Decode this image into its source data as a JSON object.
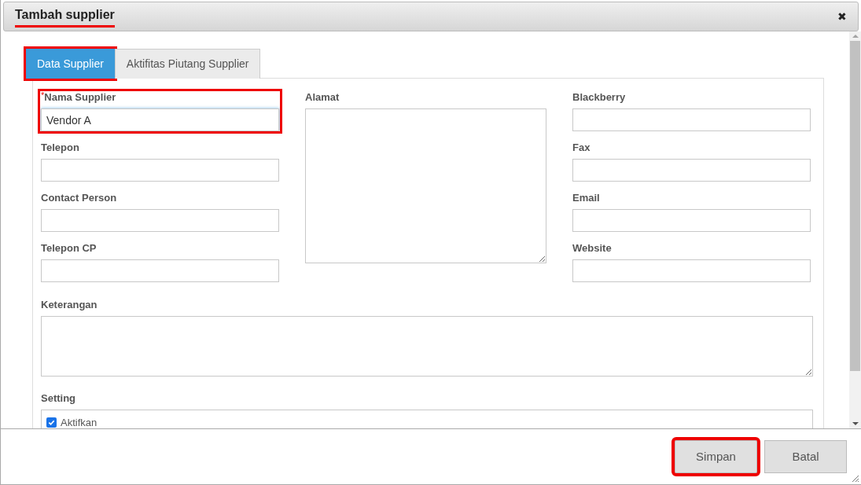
{
  "dialog": {
    "title": "Tambah supplier",
    "title_underlined": true,
    "close_glyph": "✖"
  },
  "tabs": [
    {
      "label": "Data Supplier",
      "selected": true,
      "highlighted": true
    },
    {
      "label": "Aktifitas Piutang Supplier",
      "selected": false,
      "highlighted": false
    }
  ],
  "fields_left": [
    {
      "label": "Nama Supplier",
      "required_mark": "*",
      "value": "Vendor A",
      "focused": true,
      "highlighted": true
    },
    {
      "label": "Telepon",
      "focused": false,
      "highlighted": false
    },
    {
      "label": "Contact Person",
      "focused": false,
      "highlighted": false
    },
    {
      "label": "Telepon CP",
      "focused": false,
      "highlighted": false
    }
  ],
  "address": {
    "label": "Alamat"
  },
  "fields_right": [
    {
      "label": "Blackberry"
    },
    {
      "label": "Fax"
    },
    {
      "label": "Email"
    },
    {
      "label": "Website"
    }
  ],
  "notes": {
    "label": "Keterangan"
  },
  "setting": {
    "label": "Setting",
    "options": [
      {
        "label": "Aktifkan",
        "checked": true
      }
    ]
  },
  "buttons": [
    {
      "label": "Simpan",
      "highlighted": true
    },
    {
      "label": "Batal",
      "highlighted": false
    }
  ]
}
